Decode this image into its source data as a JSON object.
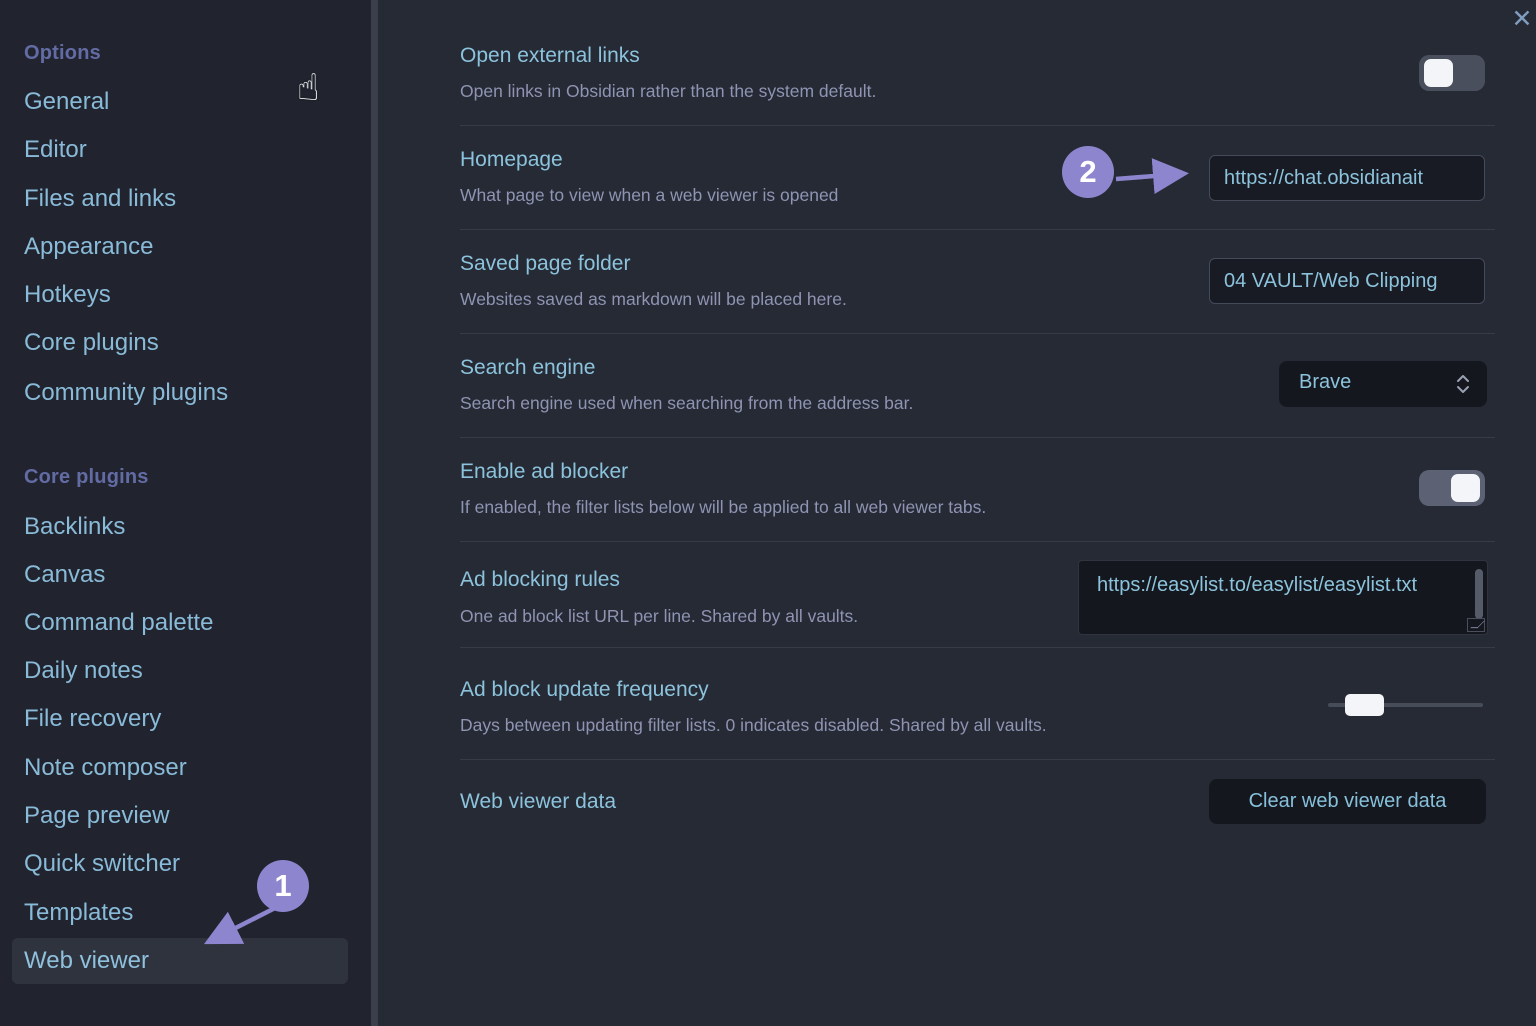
{
  "window": {
    "close_label": "✕"
  },
  "cursor": {
    "glyph": "☝"
  },
  "sidebar": {
    "section1": {
      "header": "Options",
      "items": [
        "General",
        "Editor",
        "Files and links",
        "Appearance",
        "Hotkeys",
        "Core plugins",
        "Community plugins"
      ]
    },
    "section2": {
      "header": "Core plugins",
      "items": [
        "Backlinks",
        "Canvas",
        "Command palette",
        "Daily notes",
        "File recovery",
        "Note composer",
        "Page preview",
        "Quick switcher",
        "Templates",
        "Web viewer"
      ]
    },
    "active_item": "Web viewer"
  },
  "annotations": {
    "step1": "1",
    "step2": "2"
  },
  "settings": {
    "open_external_links": {
      "name": "Open external links",
      "desc": "Open links in Obsidian rather than the system default.",
      "state": "off"
    },
    "homepage": {
      "name": "Homepage",
      "desc": "What page to view when a web viewer is opened",
      "value": "https://chat.obsidianait"
    },
    "saved_page_folder": {
      "name": "Saved page folder",
      "desc": "Websites saved as markdown will be placed here.",
      "value": "04 VAULT/Web Clipping"
    },
    "search_engine": {
      "name": "Search engine",
      "desc": "Search engine used when searching from the address bar.",
      "value": "Brave"
    },
    "enable_ad_blocker": {
      "name": "Enable ad blocker",
      "desc": "If enabled, the filter lists below will be applied to all web viewer tabs.",
      "state": "on"
    },
    "ad_blocking_rules": {
      "name": "Ad blocking rules",
      "desc": "One ad block list URL per line. Shared by all vaults.",
      "value": "https://easylist.to/easylist/easylist.txt"
    },
    "ad_block_update_frequency": {
      "name": "Ad block update frequency",
      "desc": "Days between updating filter lists. 0 indicates disabled. Shared by all vaults."
    },
    "web_viewer_data": {
      "name": "Web viewer data",
      "button_label": "Clear web viewer data"
    }
  },
  "colors": {
    "accent_annotation": "#8d86cf",
    "heading": "#8cc3dc",
    "description": "#8e94b2",
    "sidebar_header": "#636ba4",
    "sidebar_item": "#89bbd9",
    "main_bg": "#262a35",
    "sidebar_bg": "#21242e"
  }
}
